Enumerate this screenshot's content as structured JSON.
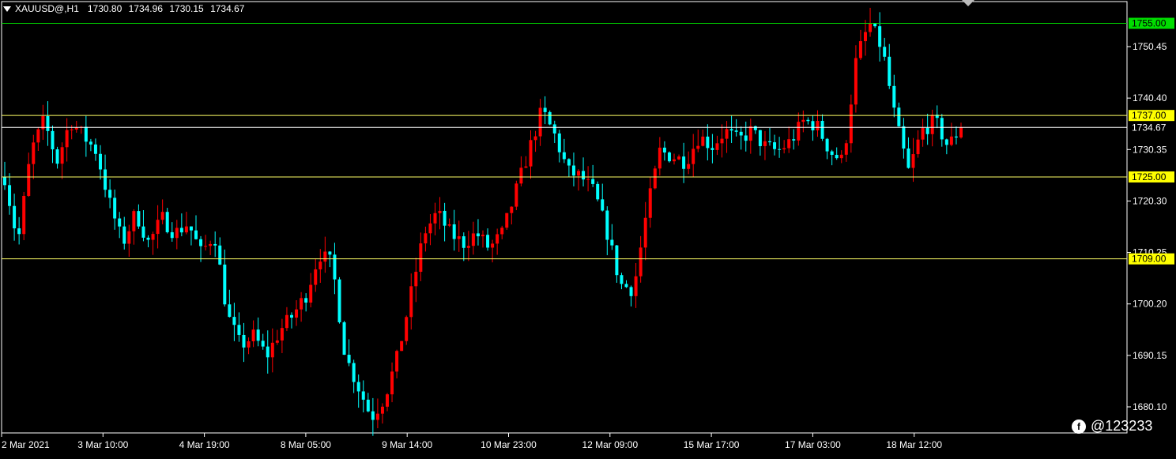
{
  "header": {
    "symbol": "XAUUSD@,H1",
    "open": "1730.80",
    "high": "1734.96",
    "low": "1730.15",
    "close": "1734.67"
  },
  "watermark": {
    "text": "@123233"
  },
  "colors": {
    "background": "#000000",
    "bull": "#ff0000",
    "bear": "#00ffff",
    "grid": "#ffffff",
    "level_line": "#ffff66",
    "top_line": "#00dd00"
  },
  "chart_data": {
    "type": "candlestick",
    "title": "",
    "symbol": "XAUUSD@",
    "timeframe": "H1",
    "y_ticks": [
      "1750.45",
      "1740.40",
      "1730.35",
      "1720.30",
      "1710.25",
      "1700.20",
      "1690.15",
      "1680.10"
    ],
    "ylim": [
      1677,
      1759
    ],
    "x_ticks": [
      "2 Mar 2021",
      "3 Mar 10:00",
      "4 Mar 19:00",
      "8 Mar 05:00",
      "9 Mar 14:00",
      "10 Mar 23:00",
      "12 Mar 09:00",
      "15 Mar 17:00",
      "17 Mar 03:00",
      "18 Mar 12:00"
    ],
    "levels": [
      {
        "label": "1755.00",
        "value": 1755.0,
        "color": "#00dd00",
        "label_bg": "#00dd00"
      },
      {
        "label": "1737.00",
        "value": 1737.0,
        "color": "#ffff66",
        "label_bg": "#ffff00"
      },
      {
        "label": "1734.67",
        "value": 1734.67,
        "color": "#ffffff",
        "label_bg": "#000000"
      },
      {
        "label": "1725.00",
        "value": 1725.0,
        "color": "#ffff66",
        "label_bg": "#ffff00"
      },
      {
        "label": "1709.00",
        "value": 1709.0,
        "color": "#ffff66",
        "label_bg": "#ffff00"
      }
    ],
    "price_path": [
      1725,
      1712,
      1730,
      1736,
      1728,
      1736,
      1733,
      1730,
      1720,
      1712,
      1718,
      1712,
      1717,
      1714,
      1716,
      1710,
      1714,
      1698,
      1692,
      1694,
      1690,
      1695,
      1698,
      1702,
      1710,
      1708,
      1690,
      1684,
      1678,
      1682,
      1690,
      1702,
      1714,
      1718,
      1714,
      1712,
      1714,
      1711,
      1714,
      1722,
      1730,
      1738,
      1733,
      1726,
      1725,
      1722,
      1714,
      1704,
      1703,
      1718,
      1730,
      1729,
      1728,
      1733,
      1731,
      1734,
      1732,
      1734,
      1731,
      1730,
      1732,
      1736,
      1735,
      1730,
      1728,
      1748,
      1755,
      1750,
      1736,
      1726,
      1734,
      1736,
      1731,
      1734.67
    ]
  }
}
